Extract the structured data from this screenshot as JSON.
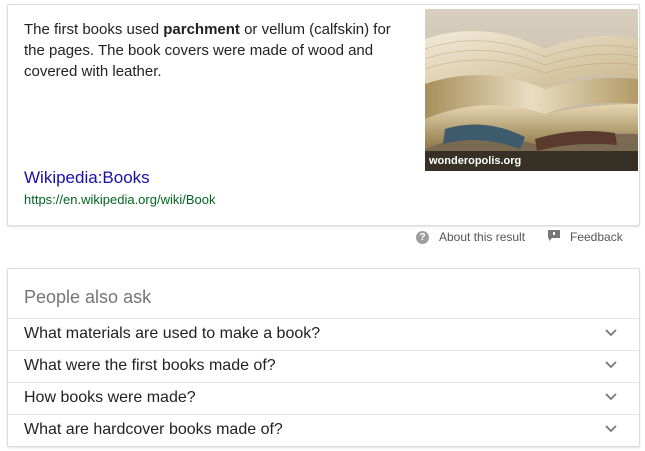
{
  "snippet": {
    "text_before": "The first books used ",
    "text_bold": "parchment",
    "text_after": " or vellum (calfskin) for the pages. The book covers were made of wood and covered with leather.",
    "link_title": "Wikipedia:Books",
    "link_url": "https://en.wikipedia.org/wiki/Book",
    "image_caption": "wonderopolis.org"
  },
  "meta": {
    "about_label": "About this result",
    "feedback_label": "Feedback",
    "about_icon": "question-circle-icon",
    "feedback_icon": "feedback-flag-icon"
  },
  "people_also_ask": {
    "title": "People also ask",
    "questions": [
      "What materials are used to make a book?",
      "What were the first books made of?",
      "How books were made?",
      "What are hardcover books made of?"
    ],
    "expand_icon": "chevron-down-icon"
  },
  "colors": {
    "link": "#1a0dab",
    "url": "#006621",
    "muted": "#757575"
  }
}
